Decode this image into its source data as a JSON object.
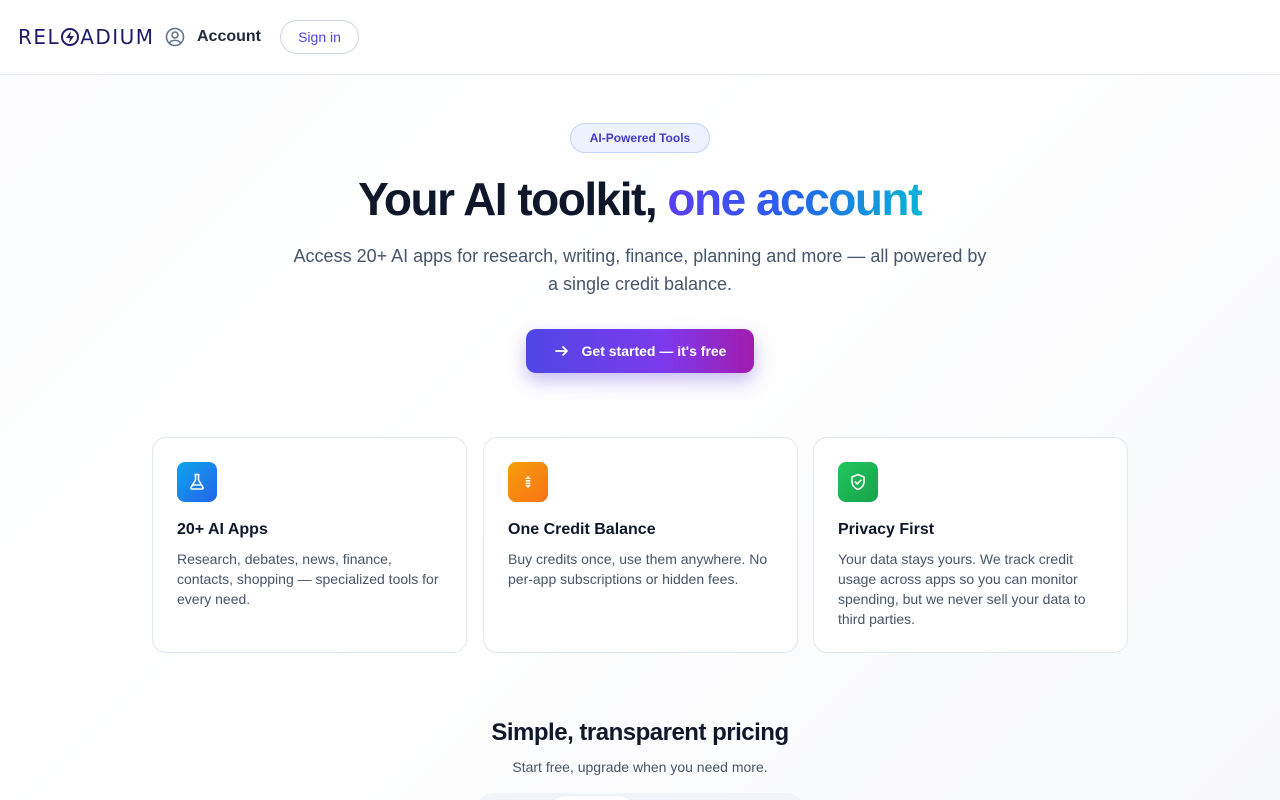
{
  "header": {
    "logo_text": "RELOADIUM",
    "account_label": "Account",
    "signin_label": "Sign in"
  },
  "hero": {
    "badge": "AI-Powered Tools",
    "title_main": "Your AI toolkit, ",
    "title_accent": "one account",
    "subtitle": "Access 20+ AI apps for research, writing, finance, planning and more — all powered by a single credit balance.",
    "cta_label": "Get started — it's free"
  },
  "features": [
    {
      "title": "20+ AI Apps",
      "description": "Research, debates, news, finance, contacts, shopping — specialized tools for every need.",
      "icon": "flask-icon",
      "color": "#0ea5e9"
    },
    {
      "title": "One Credit Balance",
      "description": "Buy credits once, use them anywhere. No per-app subscriptions or hidden fees.",
      "icon": "coins-icon",
      "color": "#f97316"
    },
    {
      "title": "Privacy First",
      "description": "Your data stays yours. We track credit usage across apps so you can monitor spending, but we never sell your data to third parties.",
      "icon": "shield-check-icon",
      "color": "#22c55e"
    }
  ],
  "pricing": {
    "title": "Simple, transparent pricing",
    "subtitle": "Start free, upgrade when you need more."
  },
  "colors": {
    "brand": "#1e1b6b",
    "accent": "#4f46e5",
    "cta_gradient_end": "#a21caf"
  }
}
